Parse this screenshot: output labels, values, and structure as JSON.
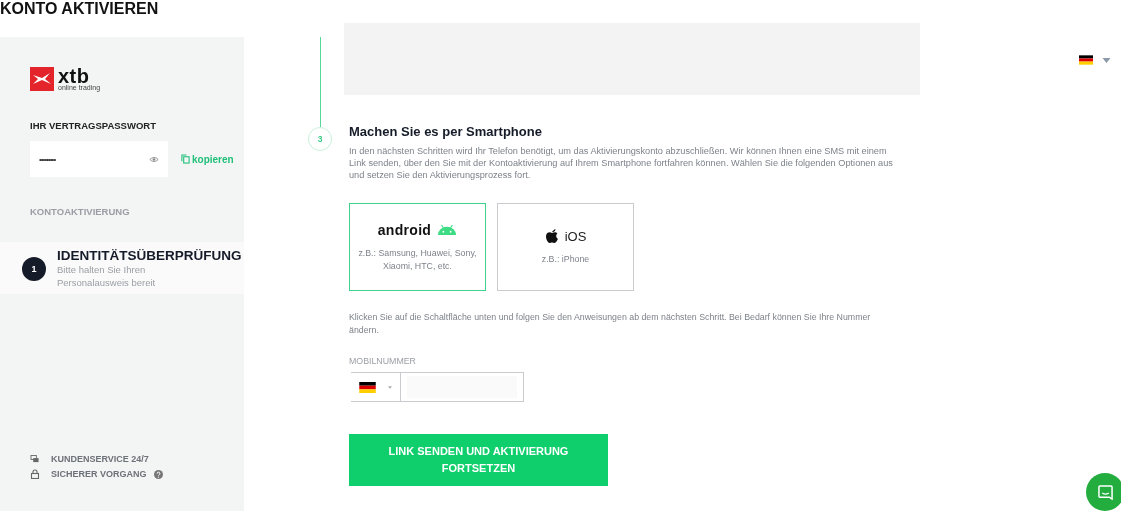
{
  "title": "KONTO AKTIVIEREN",
  "logo": {
    "name": "xtb",
    "tagline": "online trading"
  },
  "password": {
    "label": "IHR VERTRAGSPASSWORT",
    "value": "•••••••••",
    "copy": "kopieren"
  },
  "section_label": "KONTOAKTIVIERUNG",
  "current_step": {
    "number": "1",
    "title": "IDENTITÄTSÜBERPRÜFUNG",
    "subtitle": "Bitte halten Sie Ihren Personalausweis bereit"
  },
  "footer_links": [
    {
      "kind": "support",
      "label": "KUNDENSERVICE 24/7"
    },
    {
      "kind": "secure",
      "label": "SICHERER VORGANG"
    }
  ],
  "step": {
    "number": "3",
    "title": "Machen Sie es per Smartphone",
    "description": "In den nächsten Schritten wird Ihr Telefon benötigt, um das Aktivierungskonto abzuschließen. Wir können Ihnen eine SMS mit einem Link senden, über den Sie mit der Kontoaktivierung auf Ihrem Smartphone fortfahren können. Wählen Sie die folgenden Optionen aus und setzen Sie den Aktivierungsprozess fort."
  },
  "platforms": [
    {
      "kind": "android",
      "name": "android",
      "examples": "z.B.: Samsung, Huawei, Sony, Xiaomi, HTC, etc.",
      "selected": true
    },
    {
      "kind": "ios",
      "name": "iOS",
      "examples": "z.B.: iPhone",
      "selected": false
    }
  ],
  "instructions": "Klicken Sie auf die Schaltfläche unten und folgen Sie den Anweisungen ab dem nächsten Schritt. Bei Bedarf können Sie Ihre Nummer ändern.",
  "phone": {
    "label": "MOBILNUMMER"
  },
  "submit": "LINK SENDEN UND AKTIVIERUNG FORTSETZEN"
}
